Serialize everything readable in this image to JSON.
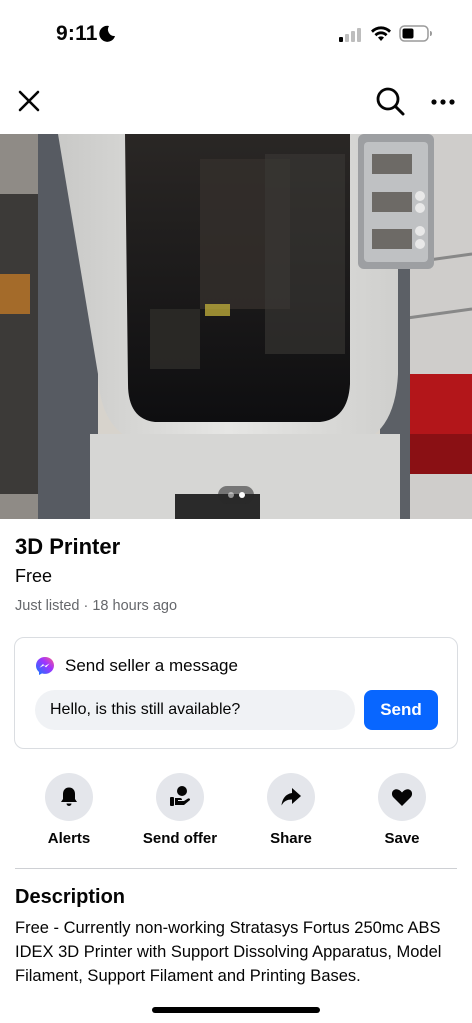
{
  "status_bar": {
    "time": "9:11"
  },
  "nav": {
    "close_icon": "close-icon",
    "search_icon": "search-icon",
    "more_icon": "more-icon"
  },
  "photo": {
    "description_icon": "product-photo",
    "page_count": 2,
    "current_page": 2
  },
  "listing": {
    "title": "3D Printer",
    "price": "Free",
    "meta": "Just listed · 18 hours ago"
  },
  "message": {
    "title": "Send seller a message",
    "input_value": "Hello, is this still available?",
    "send_label": "Send"
  },
  "actions": [
    {
      "label": "Alerts",
      "icon": "bell-icon"
    },
    {
      "label": "Send offer",
      "icon": "offer-icon"
    },
    {
      "label": "Share",
      "icon": "share-icon"
    },
    {
      "label": "Save",
      "icon": "heart-icon"
    }
  ],
  "description": {
    "heading": "Description",
    "body": "Free - Currently non-working Stratasys Fortus 250mc ABS IDEX 3D Printer with Support Dissolving Apparatus, Model Filament, Support Filament and Printing Bases."
  },
  "colors": {
    "accent": "#0866ff",
    "secondary_text": "#65676b",
    "chip_bg": "#e4e6eb"
  }
}
